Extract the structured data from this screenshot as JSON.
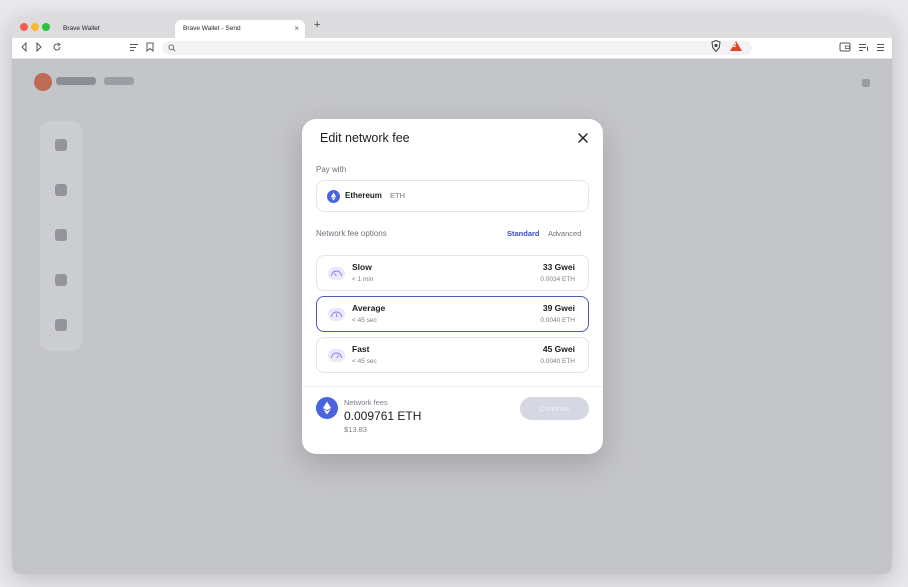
{
  "browser": {
    "tabs": [
      {
        "label": "Brave Wallet",
        "active": false
      },
      {
        "label": "Brave Wallet - Send",
        "active": true
      }
    ],
    "reward_badge": "2"
  },
  "modal": {
    "title": "Edit network fee",
    "pay_with_label": "Pay with",
    "token": {
      "name": "Ethereum",
      "symbol": "ETH"
    },
    "fee_options_label": "Network fee options",
    "tabs": {
      "standard": "Standard",
      "advanced": "Advanced",
      "active": "standard"
    },
    "options": [
      {
        "name": "Slow",
        "time": "< 1 min",
        "gwei": "33 Gwei",
        "eth": "0.0034 ETH",
        "selected": false
      },
      {
        "name": "Average",
        "time": "< 45 sec",
        "gwei": "39 Gwei",
        "eth": "0.0040 ETH",
        "selected": true
      },
      {
        "name": "Fast",
        "time": "< 45 sec",
        "gwei": "45 Gwei",
        "eth": "0.0040 ETH",
        "selected": false
      }
    ],
    "network_fees_label": "Network fees",
    "network_fees_value": "0.009761 ETH",
    "network_fees_usd": "$13.83",
    "continue_label": "Continue"
  },
  "colors": {
    "accent": "#3b4bcb",
    "eth_blue": "#4a63df",
    "selected_border": "#4c58b8",
    "continue_disabled": "#d5d7e3"
  }
}
